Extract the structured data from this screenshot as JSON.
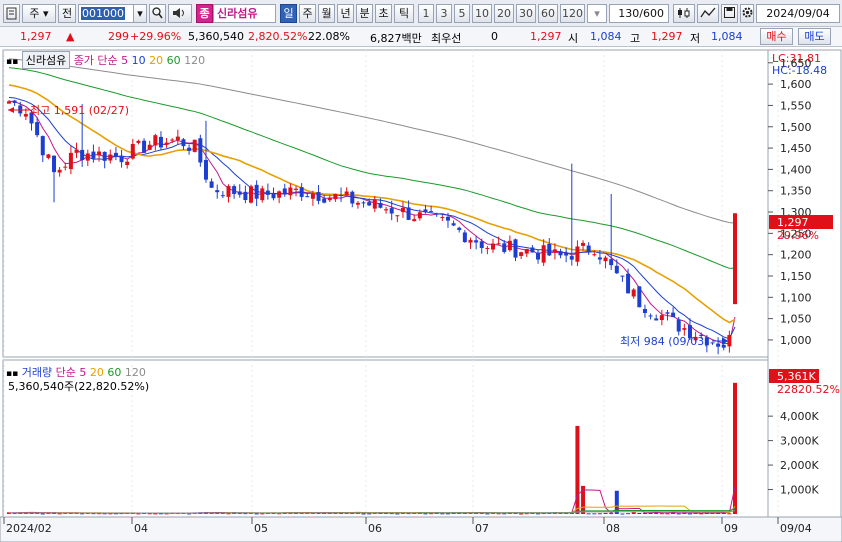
{
  "toolbar": {
    "market_label": "주",
    "prev_label": "전",
    "stock_code": "001000",
    "stock_badge": "종",
    "stock_name": "신라섬유",
    "periods": [
      "일",
      "주",
      "월",
      "년",
      "분",
      "초",
      "틱"
    ],
    "active_period": "일",
    "minute_options": [
      "1",
      "3",
      "5",
      "10",
      "20",
      "30",
      "60",
      "120"
    ],
    "count": "130/600",
    "date": "2024/09/04"
  },
  "info": {
    "price": "1,297",
    "change": "299",
    "change_pct": "+29.96%",
    "volume": "5,360,540",
    "volume_pct": "2,820.52%",
    "turnover": "22.08%",
    "amount": "6,827백만",
    "pref_label": "최우선",
    "pref_value": "0",
    "pref_price": "1,297",
    "open_label": "시",
    "open": "1,084",
    "high_label": "고",
    "high": "1,297",
    "low_label": "저",
    "low": "1,084",
    "buy_label": "매수",
    "sell_label": "매도"
  },
  "price_panel": {
    "name": "신라섬유",
    "ma_label": "종가 단순",
    "ma_periods": [
      "5",
      "10",
      "20",
      "60",
      "120"
    ],
    "lc": "LC:31.81",
    "hc": "HC:-18.48",
    "high_mark": "최고 1,591 (02/27)",
    "low_mark": "최저 984 (09/03)",
    "last_price": "1,297",
    "last_pct": "29.96%",
    "ticks": [
      "1,650",
      "1,600",
      "1,550",
      "1,500",
      "1,450",
      "1,400",
      "1,350",
      "1,300",
      "1,250",
      "1,200",
      "1,150",
      "1,100",
      "1,050",
      "1,000"
    ]
  },
  "volume_panel": {
    "label": "거래량",
    "ma_label": "단순",
    "ma_periods": [
      "5",
      "20",
      "60",
      "120"
    ],
    "value_text": "5,360,540주(22,820.52%)",
    "last_volume": "5,361K",
    "last_pct": "22820.52%",
    "ticks": [
      "4,000K",
      "3,000K",
      "2,000K",
      "1,000K"
    ]
  },
  "x_axis": {
    "labels": [
      "2024/02",
      "04",
      "05",
      "06",
      "07",
      "08",
      "09",
      "09/04"
    ]
  },
  "colors": {
    "up": "#e0101a",
    "down": "#1c3fd1",
    "ma5": "#c0188c",
    "ma10": "#1c3fd1",
    "ma20": "#e8a000",
    "ma60": "#1b9a2a",
    "ma120": "#8c8c8c"
  }
}
